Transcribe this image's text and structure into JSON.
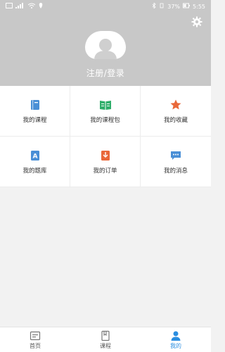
{
  "status_bar": {
    "left_icons": [
      "sim-icon",
      "signal-icon",
      "wifi-icon",
      "location-icon"
    ],
    "battery_text": "37%",
    "time": "5:55"
  },
  "header": {
    "register_label": "注册/登录"
  },
  "menu": [
    {
      "label": "我的课程",
      "icon": "notebook-icon",
      "color": "#4a8fd6"
    },
    {
      "label": "我的课程包",
      "icon": "book-open-icon",
      "color": "#2fae6a"
    },
    {
      "label": "我的收藏",
      "icon": "star-icon",
      "color": "#e9683a"
    },
    {
      "label": "我的题库",
      "icon": "question-bank-icon",
      "color": "#4a8fd6"
    },
    {
      "label": "我的订单",
      "icon": "order-icon",
      "color": "#e9683a"
    },
    {
      "label": "我的消息",
      "icon": "message-icon",
      "color": "#4a8fd6"
    }
  ],
  "bottom_nav": [
    {
      "label": "首页",
      "icon": "home-icon",
      "active": false
    },
    {
      "label": "课程",
      "icon": "course-icon",
      "active": false
    },
    {
      "label": "我的",
      "icon": "user-icon",
      "active": true
    }
  ],
  "colors": {
    "header_bg": "#c8c8c8",
    "accent": "#2b8ee0"
  }
}
